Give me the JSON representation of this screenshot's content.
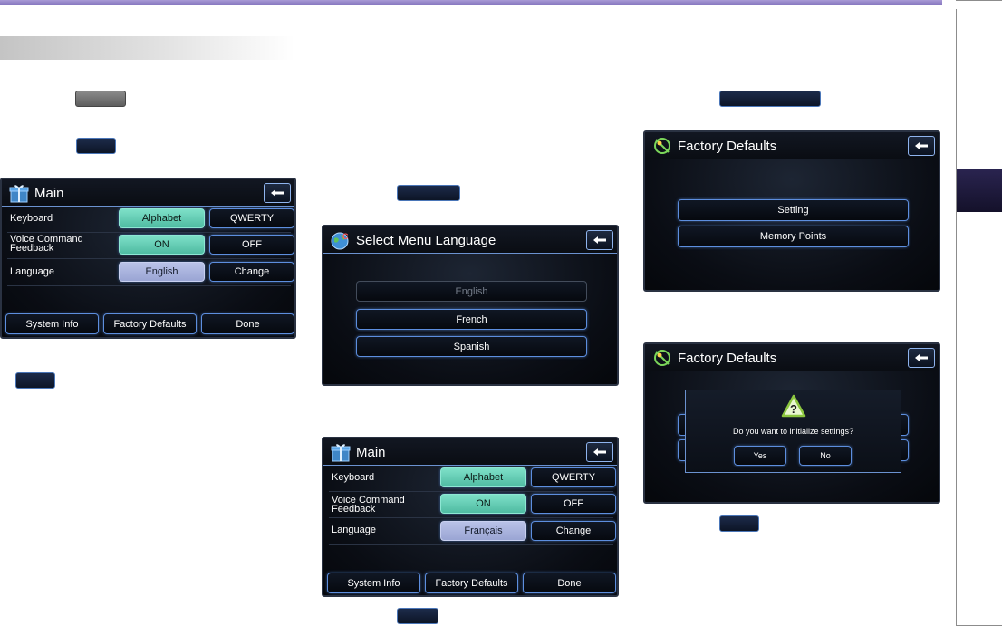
{
  "icons": {
    "back": "left-arrow-icon",
    "main": "gift-box-icon",
    "language": "globe-icon",
    "defaults": "satellite-icon",
    "warning": "warning-triangle-icon"
  },
  "colors": {
    "top_rule": "#8f80c8",
    "side_tab": "#1e1a3a",
    "active_button": "#5fcfb5",
    "language_button": "#aab3e0",
    "button_border": "#5d8ede"
  },
  "main_screen_1": {
    "title": "Main",
    "rows": [
      {
        "label": "Keyboard",
        "primary": "Alphabet",
        "secondary": "QWERTY"
      },
      {
        "label": "Voice Command Feedback",
        "primary": "ON",
        "secondary": "OFF"
      },
      {
        "label": "Language",
        "primary": "English",
        "secondary": "Change"
      }
    ],
    "bottom": [
      "System Info",
      "Factory Defaults",
      "Done"
    ]
  },
  "language_screen": {
    "title": "Select Menu Language",
    "options": [
      "English",
      "French",
      "Spanish"
    ]
  },
  "main_screen_2": {
    "title": "Main",
    "rows": [
      {
        "label": "Keyboard",
        "primary": "Alphabet",
        "secondary": "QWERTY"
      },
      {
        "label": "Voice Command Feedback",
        "primary": "ON",
        "secondary": "OFF"
      },
      {
        "label": "Language",
        "primary": "Français",
        "secondary": "Change"
      }
    ],
    "bottom": [
      "System Info",
      "Factory Defaults",
      "Done"
    ]
  },
  "defaults_screen_1": {
    "title": "Factory Defaults",
    "options": [
      "Setting",
      "Memory Points"
    ]
  },
  "defaults_screen_2": {
    "title": "Factory Defaults",
    "dialog": {
      "question": "Do you want to initialize settings?",
      "yes": "Yes",
      "no": "No"
    }
  }
}
